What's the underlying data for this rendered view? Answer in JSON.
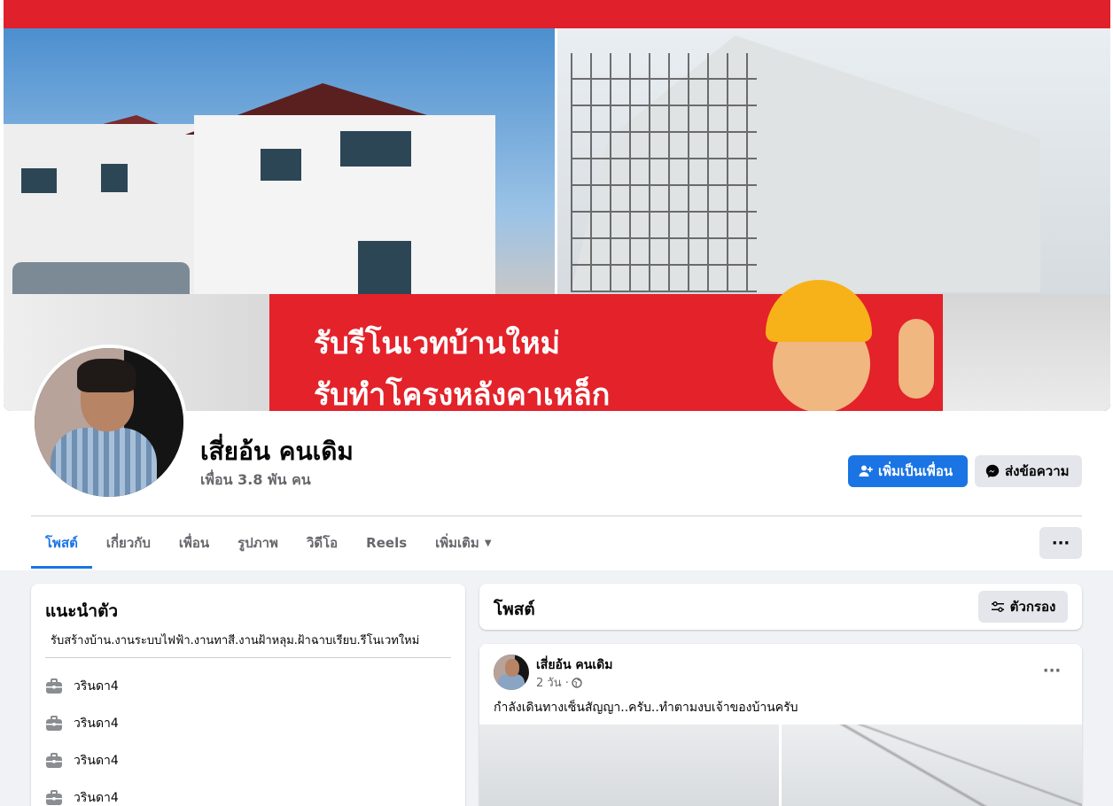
{
  "cover": {
    "banner_line1": "รับรีโนเวทบ้านใหม่",
    "banner_line2": "รับทำโครงหลังคาเหล็ก"
  },
  "profile": {
    "name": "เสี่ยอ้น คนเดิม",
    "friends": "เพื่อน 3.8 พัน คน",
    "add_friend_label": "เพิ่มเป็นเพื่อน",
    "message_label": "ส่งข้อความ"
  },
  "tabs": [
    {
      "label": "โพสต์",
      "active": true
    },
    {
      "label": "เกี่ยวกับ"
    },
    {
      "label": "เพื่อน"
    },
    {
      "label": "รูปภาพ"
    },
    {
      "label": "วิดีโอ"
    },
    {
      "label": "Reels"
    },
    {
      "label": "เพิ่มเติม"
    }
  ],
  "more_button": "···",
  "intro": {
    "title": "แนะนำตัว",
    "bio": "รับสร้างบ้าน.งานระบบไฟฟ้า.งานทาสี.งานฝ้าหลุม.ฝ้าฉาบเรียบ.รีโนเวทใหม่",
    "work_items": [
      "วรินดา4",
      "วรินดา4",
      "วรินดา4",
      "วรินดา4"
    ]
  },
  "posts_section": {
    "title": "โพสต์",
    "filter_label": "ตัวกรอง"
  },
  "post": {
    "author": "เสี่ยอ้น คนเดิม",
    "time": "2 วัน ·",
    "text": "กำลังเดินทางเซ็นสัญญา..ครับ..ทำตามงบเจ้าของบ้านครับ",
    "more": "···"
  },
  "colors": {
    "primary": "#1b74e4",
    "secondary_bg": "#e4e6eb",
    "page_bg": "#f0f2f5",
    "banner_red": "#e3222a"
  }
}
